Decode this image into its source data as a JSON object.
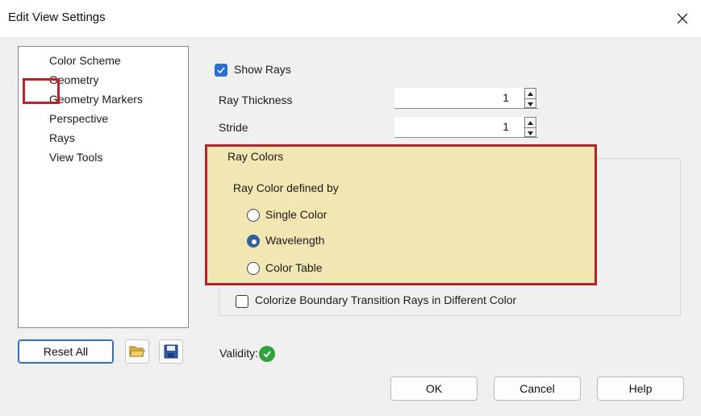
{
  "window": {
    "title": "Edit View Settings"
  },
  "tree": {
    "items": [
      "Color Scheme",
      "Geometry",
      "Geometry Markers",
      "Perspective",
      "Rays",
      "View Tools"
    ],
    "selected": "Rays"
  },
  "rays": {
    "show_rays_label": "Show Rays",
    "show_rays_checked": true,
    "thickness_label": "Ray Thickness",
    "thickness_value": "1",
    "stride_label": "Stride",
    "stride_value": "1"
  },
  "ray_colors": {
    "group_label": "Ray Colors",
    "defined_by_label": "Ray Color defined by",
    "options": [
      "Single Color",
      "Wavelength",
      "Color Table"
    ],
    "selected": "Wavelength",
    "colorize_label": "Colorize Boundary Transition Rays in Different Color",
    "colorize_checked": false
  },
  "footer": {
    "reset_all_label": "Reset All",
    "validity_label": "Validity:",
    "ok_label": "OK",
    "cancel_label": "Cancel",
    "help_label": "Help"
  },
  "colors": {
    "accent": "#2b6fcf",
    "highlight_border": "#c0222a",
    "highlight_fill": "#f2e6b3",
    "valid_green": "#2fa33b"
  }
}
